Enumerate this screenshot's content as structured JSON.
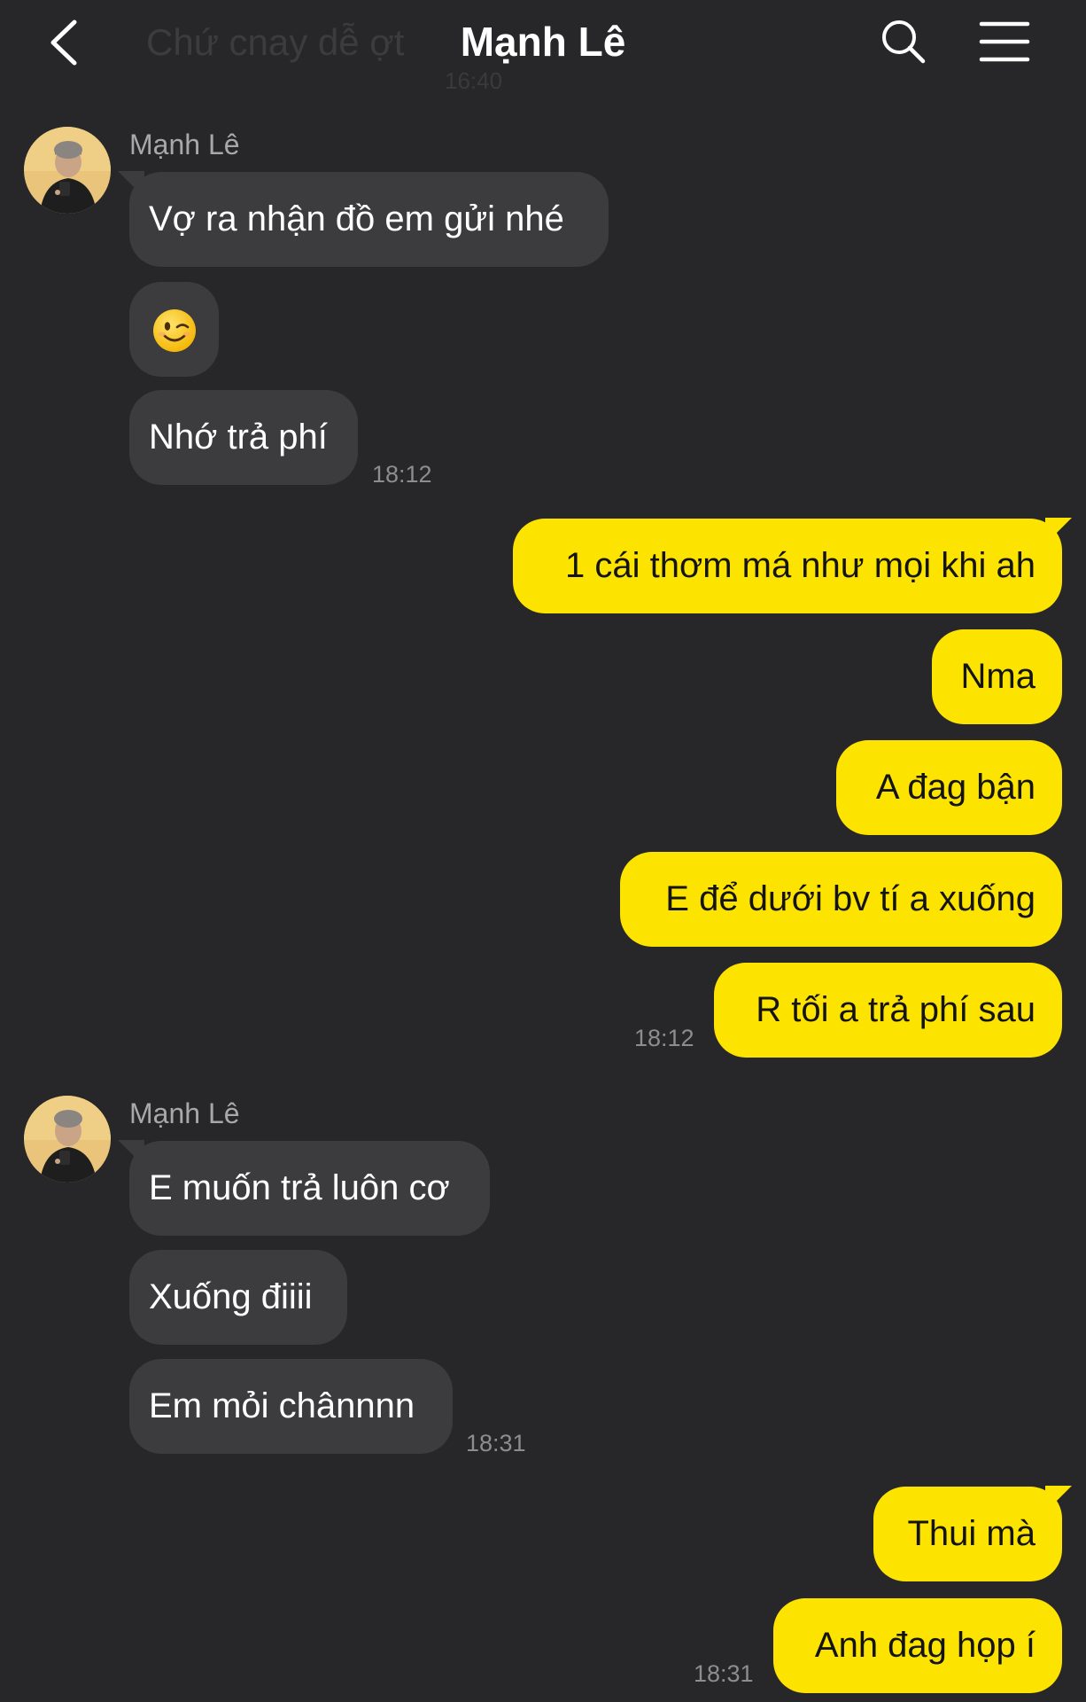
{
  "header": {
    "title": "Mạnh Lê",
    "ghost_preview": "Chứ cnay dễ ợt",
    "ghost_time": "16:40"
  },
  "icons": {
    "back": "chevron-left-icon",
    "search": "search-icon",
    "menu": "hamburger-menu-icon",
    "emoji": "winking-face-emoji-icon"
  },
  "colors": {
    "background": "#272729",
    "incoming_bubble": "#3c3c3f",
    "outgoing_bubble": "#fce300"
  },
  "group1": {
    "sender": "Mạnh Lê",
    "messages": [
      "Vợ ra nhận đồ em gửi nhé",
      "😉",
      "Nhớ trả phí"
    ],
    "time": "18:12"
  },
  "group2": {
    "messages": [
      "1 cái thơm má như mọi khi ah",
      "Nma",
      "A đag bận",
      "E để dưới bv tí a xuống",
      "R tối a trả phí sau"
    ],
    "time": "18:12"
  },
  "group3": {
    "sender": "Mạnh Lê",
    "messages": [
      "E muốn trả luôn cơ",
      "Xuống điiii",
      "Em mỏi chânnnn"
    ],
    "time": "18:31"
  },
  "group4": {
    "messages": [
      "Thui mà",
      "Anh đag họp í"
    ],
    "time": "18:31"
  }
}
